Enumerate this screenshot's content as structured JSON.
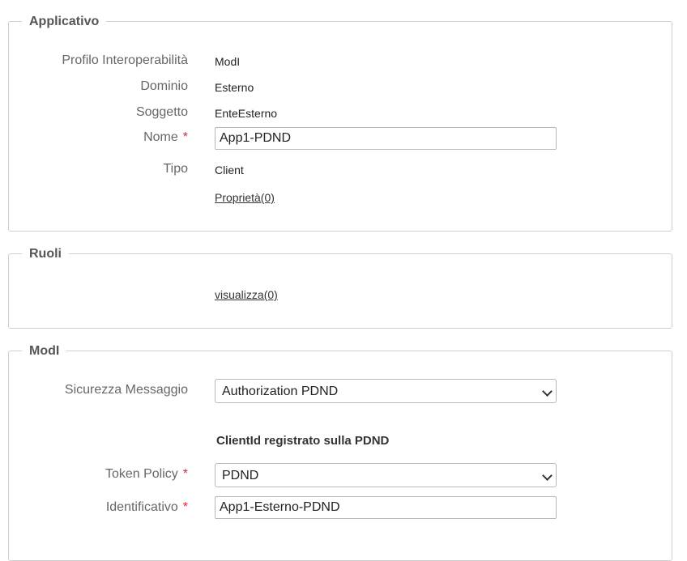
{
  "applicativo": {
    "title": "Applicativo",
    "profilo_label": "Profilo Interoperabilità",
    "profilo_value": "ModI",
    "dominio_label": "Dominio",
    "dominio_value": "Esterno",
    "soggetto_label": "Soggetto",
    "soggetto_value": "EnteEsterno",
    "nome_label": "Nome",
    "nome_value": "App1-PDND",
    "tipo_label": "Tipo",
    "tipo_value": "Client",
    "proprieta_link": "Proprietà(0)"
  },
  "ruoli": {
    "title": "Ruoli",
    "visualizza_link": "visualizza(0)"
  },
  "modi": {
    "title": "ModI",
    "sicurezza_label": "Sicurezza Messaggio",
    "sicurezza_value": "Authorization PDND",
    "clientid_heading": "ClientId registrato sulla PDND",
    "token_policy_label": "Token Policy",
    "token_policy_value": "PDND",
    "identificativo_label": "Identificativo",
    "identificativo_value": "App1-Esterno-PDND"
  },
  "required_marker": "*"
}
